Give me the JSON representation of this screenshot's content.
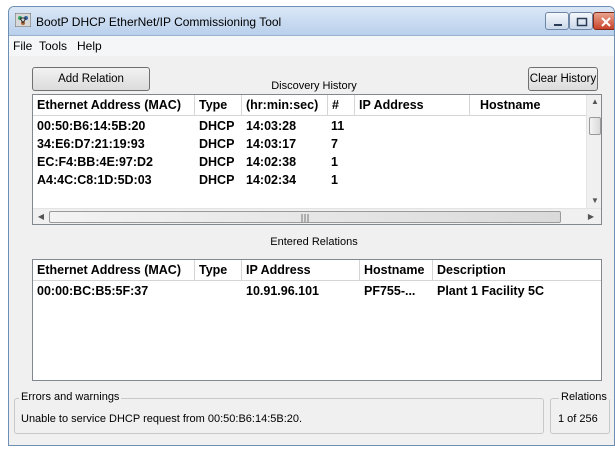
{
  "window": {
    "title": "BootP DHCP EtherNet/IP Commissioning Tool"
  },
  "menu": [
    "File",
    "Tools",
    "Help"
  ],
  "buttons": {
    "add_relation": "Add Relation",
    "clear_history": "Clear History"
  },
  "discovery": {
    "caption": "Discovery History",
    "columns": [
      "Ethernet Address (MAC)",
      "Type",
      "(hr:min:sec)",
      "#",
      "IP Address",
      "Hostname"
    ],
    "rows": [
      {
        "mac": "00:50:B6:14:5B:20",
        "type": "DHCP",
        "time": "14:03:28",
        "count": "11",
        "ip": "",
        "host": ""
      },
      {
        "mac": "34:E6:D7:21:19:93",
        "type": "DHCP",
        "time": "14:03:17",
        "count": "7",
        "ip": "",
        "host": ""
      },
      {
        "mac": "EC:F4:BB:4E:97:D2",
        "type": "DHCP",
        "time": "14:02:38",
        "count": "1",
        "ip": "",
        "host": ""
      },
      {
        "mac": "A4:4C:C8:1D:5D:03",
        "type": "DHCP",
        "time": "14:02:34",
        "count": "1",
        "ip": "",
        "host": ""
      }
    ]
  },
  "entered": {
    "caption": "Entered Relations",
    "columns": [
      "Ethernet Address (MAC)",
      "Type",
      "IP Address",
      "Hostname",
      "Description"
    ],
    "rows": [
      {
        "mac": "00:00:BC:B5:5F:37",
        "type": "",
        "ip": "10.91.96.101",
        "host": "PF755-...",
        "desc": "Plant 1 Facility 5C"
      }
    ]
  },
  "errors": {
    "title": "Errors and warnings",
    "message": "Unable to service DHCP request from 00:50:B6:14:5B:20."
  },
  "relations": {
    "title": "Relations",
    "count": "1 of 256"
  }
}
